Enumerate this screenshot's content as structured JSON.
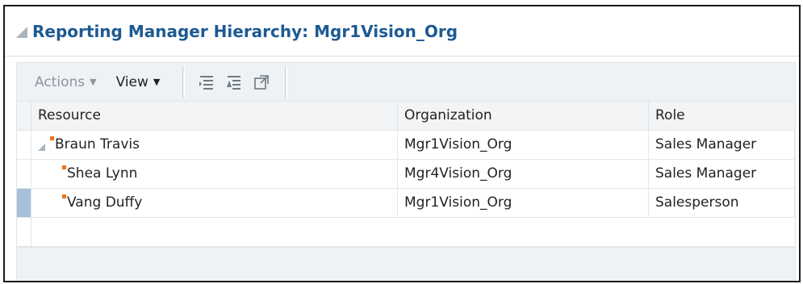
{
  "panel": {
    "title": "Reporting Manager Hierarchy: Mgr1Vision_Org"
  },
  "toolbar": {
    "actions_label": "Actions",
    "view_label": "View",
    "icons": [
      "expand-all-icon",
      "collapse-all-icon",
      "detach-icon"
    ]
  },
  "table": {
    "headers": {
      "resource": "Resource",
      "organization": "Organization",
      "role": "Role"
    },
    "rows": [
      {
        "resource": "Braun Travis",
        "organization": "Mgr1Vision_Org",
        "role": "Sales Manager",
        "level": 0,
        "expanded": true,
        "selected": false
      },
      {
        "resource": "Shea Lynn",
        "organization": "Mgr4Vision_Org",
        "role": "Sales Manager",
        "level": 1,
        "expanded": false,
        "selected": false
      },
      {
        "resource": "Vang Duffy",
        "organization": "Mgr1Vision_Org",
        "role": "Salesperson",
        "level": 1,
        "expanded": false,
        "selected": true
      }
    ]
  },
  "colors": {
    "title": "#1d5a93",
    "marker": "#e8741d",
    "selection": "#a7bfd9",
    "toolbar_bg": "#eef2f5"
  }
}
